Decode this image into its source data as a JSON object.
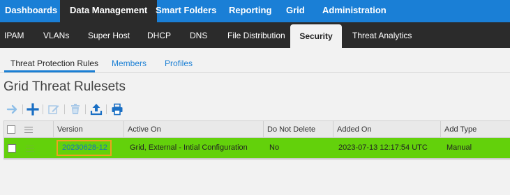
{
  "topnav": {
    "items": [
      {
        "label": "Dashboards",
        "active": false
      },
      {
        "label": "Data Management",
        "active": true
      },
      {
        "label": "Smart Folders",
        "active": false
      },
      {
        "label": "Reporting",
        "active": false
      },
      {
        "label": "Grid",
        "active": false
      },
      {
        "label": "Administration",
        "active": false
      }
    ]
  },
  "subnav": {
    "items": [
      {
        "label": "IPAM",
        "active": false
      },
      {
        "label": "VLANs",
        "active": false
      },
      {
        "label": "Super Host",
        "active": false
      },
      {
        "label": "DHCP",
        "active": false
      },
      {
        "label": "DNS",
        "active": false
      },
      {
        "label": "File Distribution",
        "active": false
      },
      {
        "label": "Security",
        "active": true
      },
      {
        "label": "Threat Analytics",
        "active": false
      }
    ]
  },
  "tabs": [
    {
      "label": "Threat Protection Rules",
      "active": true
    },
    {
      "label": "Members",
      "active": false
    },
    {
      "label": "Profiles",
      "active": false
    }
  ],
  "page_title": "Grid Threat Rulesets",
  "toolbar": {
    "icons": [
      "arrow-right-icon",
      "plus-icon",
      "edit-icon",
      "trash-icon",
      "upload-icon",
      "print-icon"
    ]
  },
  "table": {
    "columns": [
      "Version",
      "Active On",
      "Do Not Delete",
      "Added On",
      "Add Type"
    ],
    "rows": [
      {
        "version": "20230628-12",
        "active_on": "Grid, External - Intial Configuration",
        "do_not_delete": "No",
        "added_on": "2023-07-13 12:17:54 UTC",
        "add_type": "Manual"
      }
    ]
  },
  "colors": {
    "brand_blue": "#1a7fd6",
    "nav_dark": "#2b2b2b",
    "row_selected": "#63d10b",
    "focus_outline": "#f0a020"
  }
}
